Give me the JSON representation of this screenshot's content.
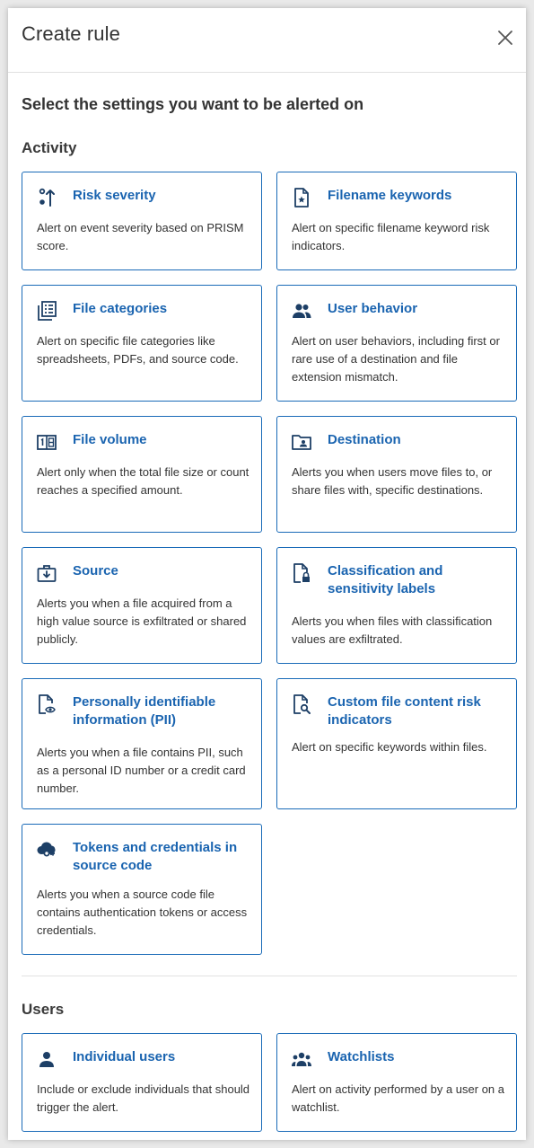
{
  "header": {
    "title": "Create rule",
    "close_icon": "close-icon"
  },
  "main": {
    "heading": "Select the settings you want to be alerted on",
    "activity_label": "Activity",
    "users_label": "Users"
  },
  "colors": {
    "accent": "#1a64b0",
    "border": "#1a6bb8"
  },
  "activity": [
    {
      "title": "Risk severity",
      "desc": "Alert on event severity based on PRISM score.",
      "icon": "risk-severity-icon"
    },
    {
      "title": "Filename keywords",
      "desc": "Alert on specific filename keyword risk indicators.",
      "icon": "file-star-icon"
    },
    {
      "title": "File categories",
      "desc": "Alert on specific file categories like spreadsheets, PDFs, and source code.",
      "icon": "file-categories-icon"
    },
    {
      "title": "User behavior",
      "desc": "Alert on user behaviors, including first or rare use of a destination and file extension mismatch.",
      "icon": "users-icon"
    },
    {
      "title": "File volume",
      "desc": "Alert only when the total file size or count reaches a specified amount.",
      "icon": "file-volume-icon"
    },
    {
      "title": "Destination",
      "desc": "Alerts you when users move files to, or share files with, specific destinations.",
      "icon": "folder-user-icon"
    },
    {
      "title": "Source",
      "desc": "Alerts you when a file acquired from a high value source is exfiltrated or shared publicly.",
      "icon": "briefcase-download-icon"
    },
    {
      "title": "Classification and sensitivity labels",
      "desc": "Alerts you when files with classification values are exfiltrated.",
      "icon": "file-lock-icon"
    },
    {
      "title": "Personally identifiable information (PII)",
      "desc": "Alerts you when a file contains PII, such as a personal ID number or a credit card number.",
      "icon": "file-eye-icon"
    },
    {
      "title": "Custom file content risk indicators",
      "desc": "Alert on specific keywords within files.",
      "icon": "file-search-icon"
    },
    {
      "title": "Tokens and credentials in source code",
      "desc": "Alerts you when a source code file contains authentication tokens or access credentials.",
      "icon": "cloud-key-icon"
    }
  ],
  "users": [
    {
      "title": "Individual users",
      "desc": "Include or exclude individuals that should trigger the alert.",
      "icon": "user-icon"
    },
    {
      "title": "Watchlists",
      "desc": "Alert on activity performed by a user on a watchlist.",
      "icon": "group-icon"
    }
  ]
}
